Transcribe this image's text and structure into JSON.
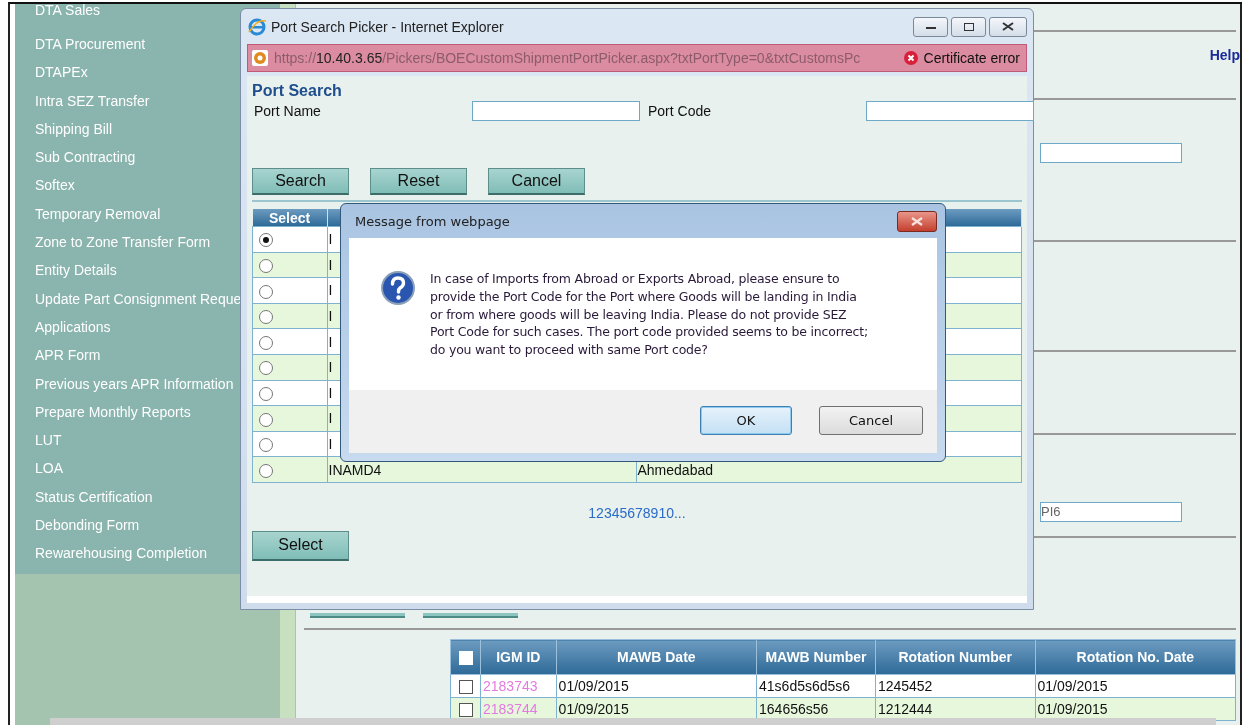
{
  "sidebar": {
    "items": [
      "DTA Sales",
      "DTA Procurement",
      "DTAPEx",
      "Intra SEZ Transfer",
      "Shipping Bill",
      "Sub Contracting",
      "Softex",
      "Temporary Removal",
      "Zone to Zone Transfer Form",
      "Entity Details",
      "Update Part Consignment Reque",
      "Applications",
      "APR Form",
      "Previous years APR Information",
      "Prepare Monthly Reports",
      "LUT",
      "LOA",
      "Status Certification",
      "Debonding Form",
      "Rewarehousing Completion"
    ]
  },
  "page": {
    "help_link": "Help",
    "field_value": "PI6",
    "table": {
      "all_checked": false,
      "columns": [
        "IGM ID",
        "MAWB Date",
        "MAWB Number",
        "Rotation Number",
        "Rotation No. Date"
      ],
      "rows": [
        {
          "checked": false,
          "cells": [
            "2183743",
            "01/09/2015",
            "41s6d5s6d5s6",
            "1245452",
            "01/09/2015"
          ]
        },
        {
          "checked": false,
          "cells": [
            "2183744",
            "01/09/2015",
            "164656s56",
            "1212444",
            "01/09/2015"
          ]
        }
      ]
    }
  },
  "popup": {
    "title": "Port Search Picker - Internet Explorer",
    "url": {
      "scheme": "https://",
      "host": "10.40.3.65",
      "path": "/Pickers/BOECustomShipmentPortPicker.aspx?txtPortType=0&txtCustomsPc"
    },
    "certificate": "Certificate error",
    "heading": "Port Search",
    "fields": [
      {
        "label": "Port Name"
      },
      {
        "label": "Port Code"
      }
    ],
    "buttons": [
      "Search",
      "Reset",
      "Cancel"
    ],
    "grid": {
      "columns": [
        "Select"
      ],
      "rows": [
        {
          "selected": true,
          "code": "I"
        },
        {
          "selected": false,
          "code": "I"
        },
        {
          "selected": false,
          "code": "I"
        },
        {
          "selected": false,
          "code": "I"
        },
        {
          "selected": false,
          "code": "I"
        },
        {
          "selected": false,
          "code": "I"
        },
        {
          "selected": false,
          "code": "I"
        },
        {
          "selected": false,
          "code": "I"
        },
        {
          "selected": false,
          "code": "I"
        },
        {
          "selected": false,
          "code": "INAMD4",
          "name": "Ahmedabad"
        }
      ]
    },
    "pager": "12345678910...",
    "select_button": "Select"
  },
  "dialog": {
    "title": "Message from webpage",
    "message": "In case of Imports from Abroad or Exports Abroad, please ensure to provide the Port Code for the Port where Goods will be landing in India or from where goods will be leaving India. Please do not provide SEZ Port Code for such cases. The port code provided seems to be incorrect; do you want to proceed with same Port code?",
    "buttons": [
      "OK",
      "Cancel"
    ]
  }
}
